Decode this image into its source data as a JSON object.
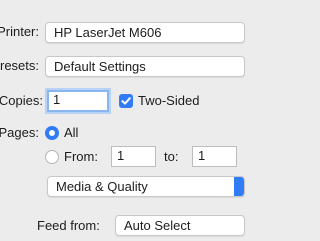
{
  "printer": {
    "label": "Printer:",
    "value": "HP LaserJet M606"
  },
  "presets": {
    "label": "Presets:",
    "value": "Default Settings"
  },
  "copies": {
    "label": "Copies:",
    "value": "1"
  },
  "two_sided": {
    "label": "Two-Sided",
    "checked": true
  },
  "pages": {
    "label": "Pages:",
    "all_label": "All",
    "from_label": "From:",
    "from_value": "1",
    "to_label": "to:",
    "to_value": "1"
  },
  "section_menu": {
    "value": "Media & Quality"
  },
  "feed_from": {
    "label": "Feed from:",
    "value": "Auto Select"
  },
  "colors": {
    "accent": "#2f7cf6"
  }
}
